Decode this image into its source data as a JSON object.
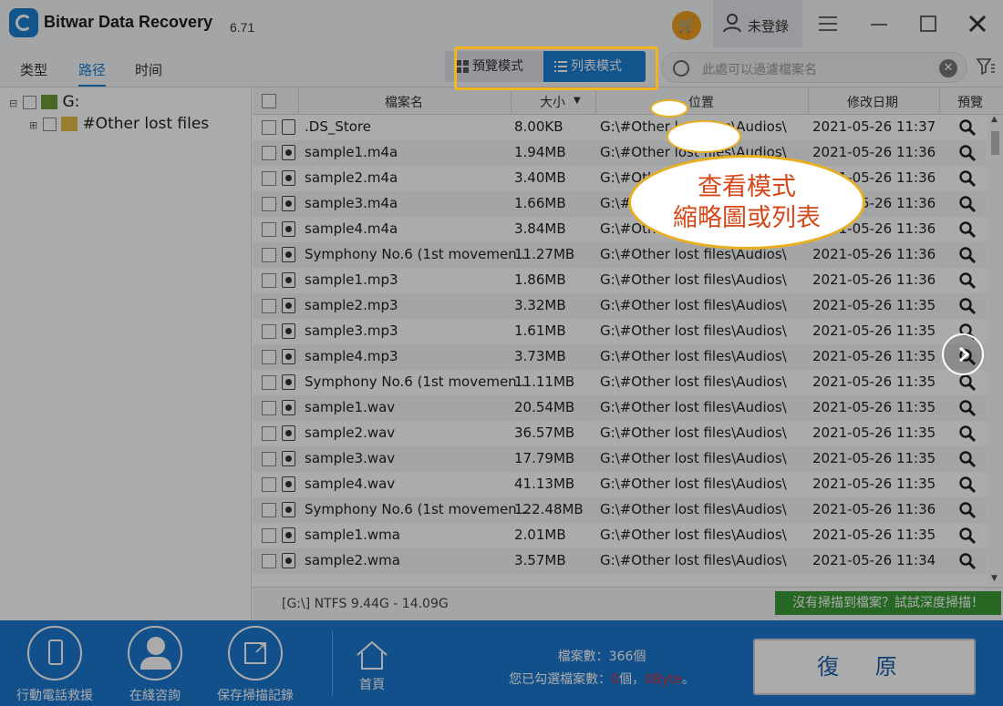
{
  "window": {
    "title": "Bitwar Data Recovery",
    "version": "6.71",
    "user_label": "未登錄"
  },
  "left_tabs": [
    "类型",
    "路径",
    "时间"
  ],
  "view_modes": {
    "thumbnail": "預覽模式",
    "list": "列表模式"
  },
  "search": {
    "placeholder": "此處可以過濾檔案名"
  },
  "tree": {
    "root": "G:",
    "child": "#Other lost files"
  },
  "columns": {
    "name": "檔案名",
    "size": "大小",
    "location": "位置",
    "modified": "修改日期",
    "preview": "預覽"
  },
  "files": [
    {
      "name": ".DS_Store",
      "size": "8.00KB",
      "path": "G:\\#Other lost files\\Audios\\",
      "date": "2021-05-26  11:37",
      "type": "doc"
    },
    {
      "name": "sample1.m4a",
      "size": "1.94MB",
      "path": "G:\\#Other lost files\\Audios\\",
      "date": "2021-05-26  11:36",
      "type": "audio"
    },
    {
      "name": "sample2.m4a",
      "size": "3.40MB",
      "path": "G:\\#Other lost files\\Audios\\",
      "date": "2021-05-26  11:36",
      "type": "audio"
    },
    {
      "name": "sample3.m4a",
      "size": "1.66MB",
      "path": "G:\\#Other lost files\\Audios\\",
      "date": "2021-05-26  11:36",
      "type": "audio"
    },
    {
      "name": "sample4.m4a",
      "size": "3.84MB",
      "path": "G:\\#Other lost files\\Audios\\",
      "date": "2021-05-26  11:36",
      "type": "audio"
    },
    {
      "name": "Symphony No.6 (1st movemen...",
      "size": "11.27MB",
      "path": "G:\\#Other lost files\\Audios\\",
      "date": "2021-05-26  11:36",
      "type": "audio"
    },
    {
      "name": "sample1.mp3",
      "size": "1.86MB",
      "path": "G:\\#Other lost files\\Audios\\",
      "date": "2021-05-26  11:36",
      "type": "audio"
    },
    {
      "name": "sample2.mp3",
      "size": "3.32MB",
      "path": "G:\\#Other lost files\\Audios\\",
      "date": "2021-05-26  11:35",
      "type": "audio"
    },
    {
      "name": "sample3.mp3",
      "size": "1.61MB",
      "path": "G:\\#Other lost files\\Audios\\",
      "date": "2021-05-26  11:35",
      "type": "audio"
    },
    {
      "name": "sample4.mp3",
      "size": "3.73MB",
      "path": "G:\\#Other lost files\\Audios\\",
      "date": "2021-05-26  11:35",
      "type": "audio"
    },
    {
      "name": "Symphony No.6 (1st movemen...",
      "size": "11.11MB",
      "path": "G:\\#Other lost files\\Audios\\",
      "date": "2021-05-26  11:35",
      "type": "audio"
    },
    {
      "name": "sample1.wav",
      "size": "20.54MB",
      "path": "G:\\#Other lost files\\Audios\\",
      "date": "2021-05-26  11:35",
      "type": "audio"
    },
    {
      "name": "sample2.wav",
      "size": "36.57MB",
      "path": "G:\\#Other lost files\\Audios\\",
      "date": "2021-05-26  11:35",
      "type": "audio"
    },
    {
      "name": "sample3.wav",
      "size": "17.79MB",
      "path": "G:\\#Other lost files\\Audios\\",
      "date": "2021-05-26  11:35",
      "type": "audio"
    },
    {
      "name": "sample4.wav",
      "size": "41.13MB",
      "path": "G:\\#Other lost files\\Audios\\",
      "date": "2021-05-26  11:35",
      "type": "audio"
    },
    {
      "name": "Symphony No.6 (1st movemen...",
      "size": "122.48MB",
      "path": "G:\\#Other lost files\\Audios\\",
      "date": "2021-05-26  11:36",
      "type": "audio"
    },
    {
      "name": "sample1.wma",
      "size": "2.01MB",
      "path": "G:\\#Other lost files\\Audios\\",
      "date": "2021-05-26  11:35",
      "type": "audio"
    },
    {
      "name": "sample2.wma",
      "size": "3.57MB",
      "path": "G:\\#Other lost files\\Audios\\",
      "date": "2021-05-26  11:34",
      "type": "audio"
    }
  ],
  "status": {
    "drive_info": "[G:\\] NTFS 9.44G - 14.09G",
    "deep_scan": "沒有掃描到檔案？試試深度掃描！"
  },
  "bottom": {
    "buttons": [
      "行動電話救援",
      "在綫咨詢",
      "保存掃描記錄",
      "首頁"
    ],
    "file_count_label": "檔案數：366個",
    "selected_prefix": "您已勾選檔案數：",
    "selected_count": "0",
    "selected_unit": "個，",
    "selected_size": "0Byte",
    "selected_suffix": "。",
    "recover": "復 原"
  },
  "callout": {
    "line1": "查看模式",
    "line2": "縮略圖或列表"
  },
  "colors": {
    "accent": "#1c7fd3",
    "highlight": "#f2b41f",
    "callout_text": "#d6481a",
    "deep_scan": "#3a9a35"
  }
}
